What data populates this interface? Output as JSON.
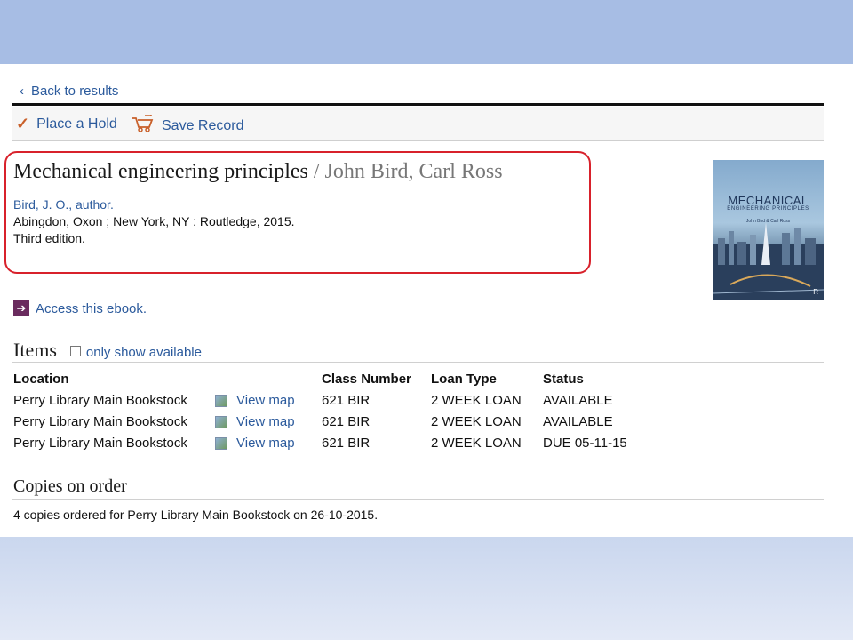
{
  "nav": {
    "back_label": "Back to results"
  },
  "toolbar": {
    "place_hold_label": "Place a Hold",
    "save_record_label": "Save Record"
  },
  "record": {
    "title": "Mechanical engineering principles",
    "responsibility": " / John Bird, Carl Ross",
    "author": "Bird, J. O., author.",
    "publication": "Abingdon, Oxon ; New York, NY : Routledge, 2015.",
    "edition": "Third edition."
  },
  "cover": {
    "title": "MECHANICAL",
    "subtitle": "ENGINEERING PRINCIPLES",
    "authors": "John Bird & Carl Ross",
    "publisher_mark": "R"
  },
  "access": {
    "label": "Access this ebook."
  },
  "items": {
    "heading": "Items",
    "only_available_label": "only show available",
    "columns": [
      "Location",
      "Class Number",
      "Loan Type",
      "Status"
    ],
    "rows": [
      {
        "location": "Perry Library Main Bookstock",
        "map": "View map",
        "class_number": "621 BIR",
        "loan_type": "2 WEEK LOAN",
        "status": "AVAILABLE"
      },
      {
        "location": "Perry Library Main Bookstock",
        "map": "View map",
        "class_number": "621 BIR",
        "loan_type": "2 WEEK LOAN",
        "status": "AVAILABLE"
      },
      {
        "location": "Perry Library Main Bookstock",
        "map": "View map",
        "class_number": "621 BIR",
        "loan_type": "2 WEEK LOAN",
        "status": "DUE 05-11-15"
      }
    ]
  },
  "copies": {
    "heading": "Copies on order",
    "text": "4 copies ordered for Perry Library Main Bookstock on 26-10-2015."
  },
  "colors": {
    "link": "#2b5a9c",
    "highlight_border": "#d8212b",
    "hold_check": "#c9602a",
    "ebook_arrow": "#6a2b5e",
    "header_band": "#a7bde4"
  }
}
